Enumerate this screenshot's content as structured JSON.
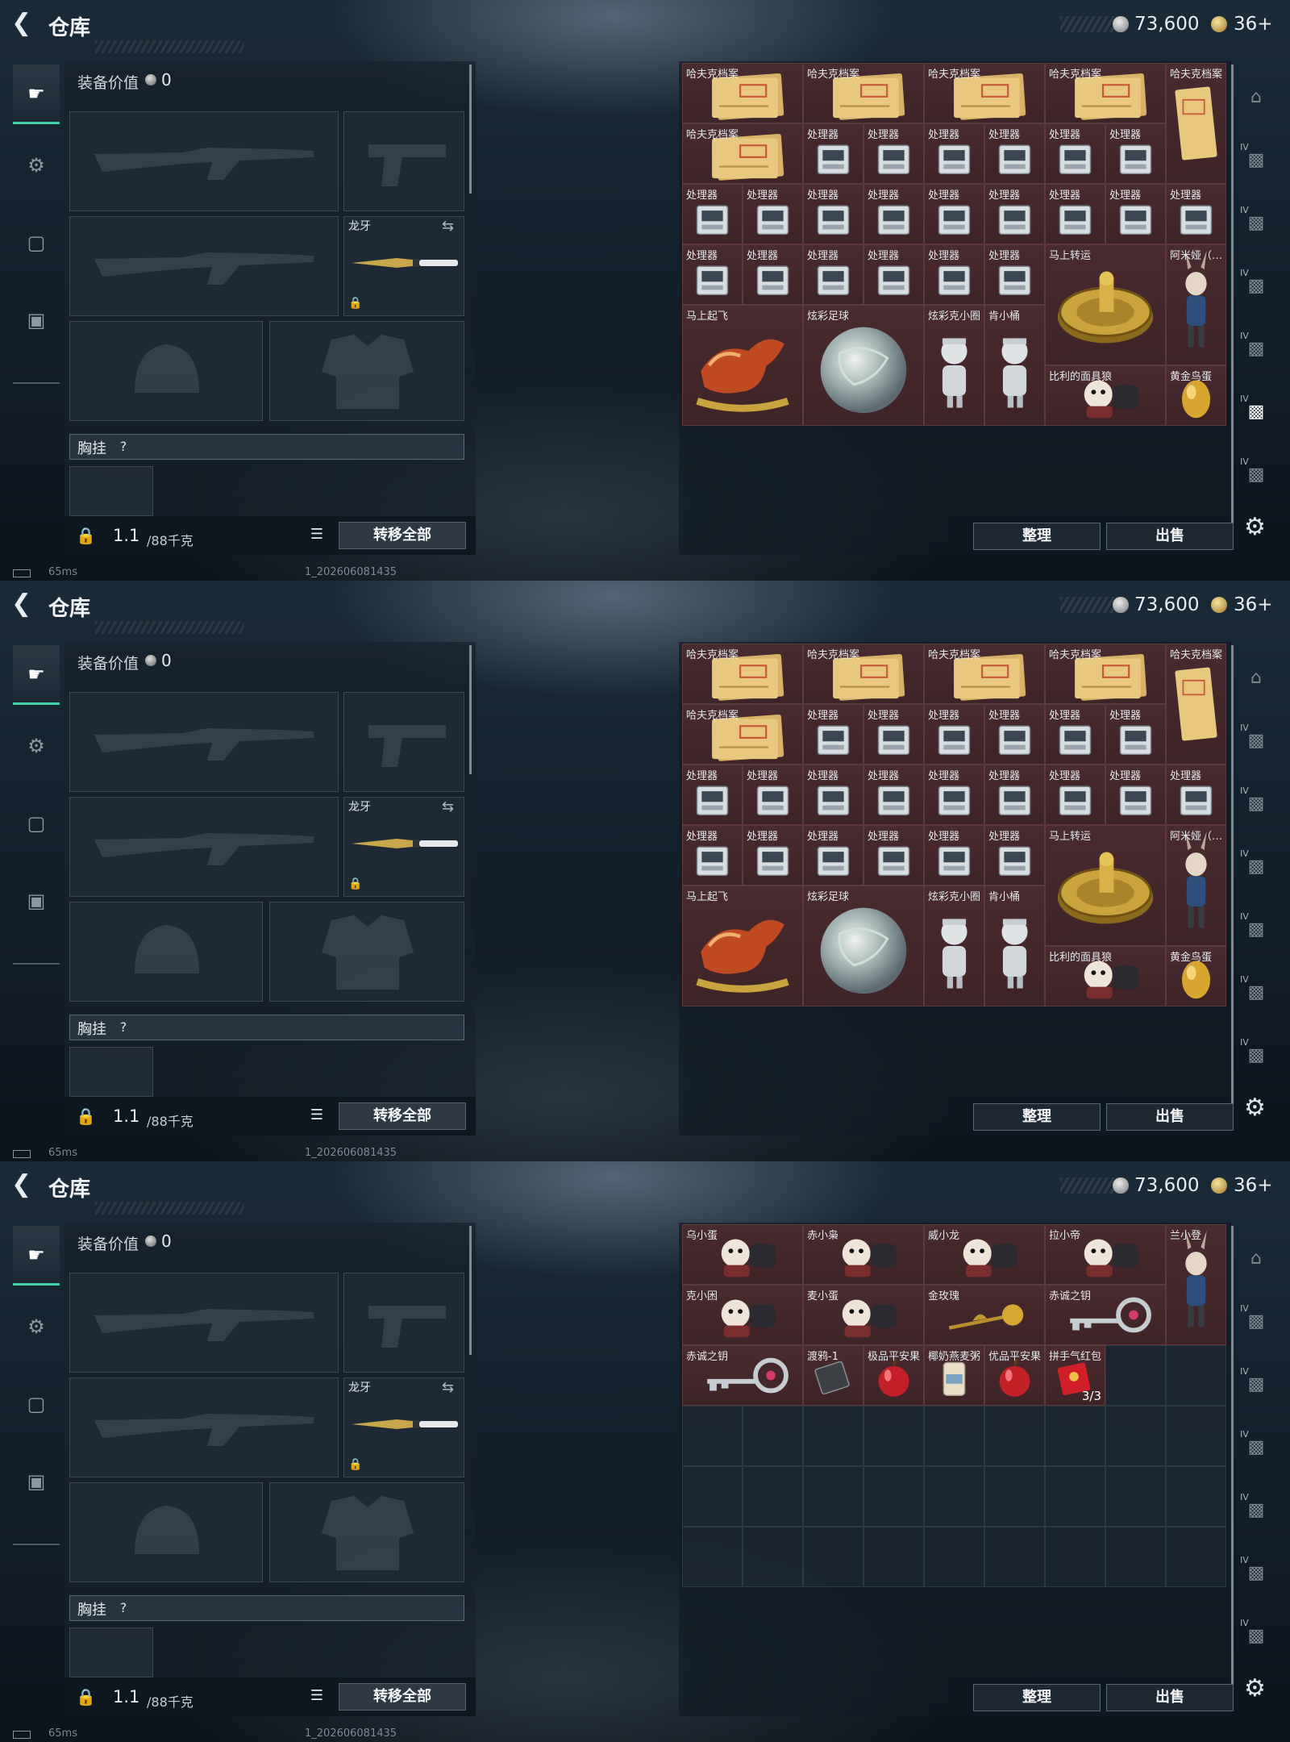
{
  "header": {
    "back_label": "<",
    "title": "仓库",
    "silver": "73,600",
    "gold": "36+"
  },
  "loadout": {
    "value_label": "装备价值",
    "value": "0",
    "melee_name": "龙牙",
    "chest_label": "胸挂",
    "chest_help": "?",
    "weight_value": "1.1",
    "weight_unit": "/88千克",
    "transfer_label": "转移全部"
  },
  "status": {
    "latency": "65ms",
    "build": "1_202606081435"
  },
  "buttons": {
    "sort": "整理",
    "sell": "出售"
  },
  "side_tabs": {
    "tag": "IV"
  },
  "colors": {
    "accent": "#3fd0a6",
    "item_bg": "#4a2b2f"
  },
  "panels": [
    {
      "items": [
        {
          "name": "哈夫克档案",
          "col": 0,
          "row": 0,
          "w": 2,
          "h": 1,
          "icon": "file"
        },
        {
          "name": "哈夫克档案",
          "col": 2,
          "row": 0,
          "w": 2,
          "h": 1,
          "icon": "file"
        },
        {
          "name": "哈夫克档案",
          "col": 4,
          "row": 0,
          "w": 2,
          "h": 1,
          "icon": "file"
        },
        {
          "name": "哈夫克档案",
          "col": 6,
          "row": 0,
          "w": 2,
          "h": 1,
          "icon": "file"
        },
        {
          "name": "哈夫克档案",
          "col": 8,
          "row": 0,
          "w": 1,
          "h": 2,
          "icon": "filev"
        },
        {
          "name": "哈夫克档案",
          "col": 0,
          "row": 1,
          "w": 2,
          "h": 1,
          "icon": "file"
        },
        {
          "name": "处理器",
          "col": 2,
          "row": 1,
          "w": 1,
          "h": 1,
          "icon": "cpu"
        },
        {
          "name": "处理器",
          "col": 3,
          "row": 1,
          "w": 1,
          "h": 1,
          "icon": "cpu"
        },
        {
          "name": "处理器",
          "col": 4,
          "row": 1,
          "w": 1,
          "h": 1,
          "icon": "cpu"
        },
        {
          "name": "处理器",
          "col": 5,
          "row": 1,
          "w": 1,
          "h": 1,
          "icon": "cpu"
        },
        {
          "name": "处理器",
          "col": 6,
          "row": 1,
          "w": 1,
          "h": 1,
          "icon": "cpu"
        },
        {
          "name": "处理器",
          "col": 7,
          "row": 1,
          "w": 1,
          "h": 1,
          "icon": "cpu"
        },
        {
          "name": "处理器",
          "col": 0,
          "row": 2,
          "w": 1,
          "h": 1,
          "icon": "cpu"
        },
        {
          "name": "处理器",
          "col": 1,
          "row": 2,
          "w": 1,
          "h": 1,
          "icon": "cpu"
        },
        {
          "name": "处理器",
          "col": 2,
          "row": 2,
          "w": 1,
          "h": 1,
          "icon": "cpu"
        },
        {
          "name": "处理器",
          "col": 3,
          "row": 2,
          "w": 1,
          "h": 1,
          "icon": "cpu"
        },
        {
          "name": "处理器",
          "col": 4,
          "row": 2,
          "w": 1,
          "h": 1,
          "icon": "cpu"
        },
        {
          "name": "处理器",
          "col": 5,
          "row": 2,
          "w": 1,
          "h": 1,
          "icon": "cpu"
        },
        {
          "name": "处理器",
          "col": 6,
          "row": 2,
          "w": 1,
          "h": 1,
          "icon": "cpu"
        },
        {
          "name": "处理器",
          "col": 7,
          "row": 2,
          "w": 1,
          "h": 1,
          "icon": "cpu"
        },
        {
          "name": "处理器",
          "col": 8,
          "row": 2,
          "w": 1,
          "h": 1,
          "icon": "cpu"
        },
        {
          "name": "处理器",
          "col": 0,
          "row": 3,
          "w": 1,
          "h": 1,
          "icon": "cpu"
        },
        {
          "name": "处理器",
          "col": 1,
          "row": 3,
          "w": 1,
          "h": 1,
          "icon": "cpu"
        },
        {
          "name": "处理器",
          "col": 2,
          "row": 3,
          "w": 1,
          "h": 1,
          "icon": "cpu"
        },
        {
          "name": "处理器",
          "col": 3,
          "row": 3,
          "w": 1,
          "h": 1,
          "icon": "cpu"
        },
        {
          "name": "处理器",
          "col": 4,
          "row": 3,
          "w": 1,
          "h": 1,
          "icon": "cpu"
        },
        {
          "name": "处理器",
          "col": 5,
          "row": 3,
          "w": 1,
          "h": 1,
          "icon": "cpu"
        },
        {
          "name": "马上转运",
          "col": 6,
          "row": 3,
          "w": 2,
          "h": 2,
          "icon": "wheel"
        },
        {
          "name": "阿米娅（…",
          "col": 8,
          "row": 3,
          "w": 1,
          "h": 2,
          "icon": "figure"
        },
        {
          "name": "马上起飞",
          "col": 0,
          "row": 4,
          "w": 2,
          "h": 2,
          "icon": "horse"
        },
        {
          "name": "炫彩足球",
          "col": 2,
          "row": 4,
          "w": 2,
          "h": 2,
          "icon": "ball"
        },
        {
          "name": "炫彩克小圈",
          "col": 4,
          "row": 4,
          "w": 1,
          "h": 2,
          "icon": "statue"
        },
        {
          "name": "肯小桶",
          "col": 5,
          "row": 4,
          "w": 1,
          "h": 2,
          "icon": "statue"
        },
        {
          "name": "比利的面具狼",
          "col": 6,
          "row": 5,
          "w": 2,
          "h": 1,
          "icon": "doll"
        },
        {
          "name": "黄金鸟蛋",
          "col": 8,
          "row": 5,
          "w": 1,
          "h": 1,
          "icon": "egg"
        }
      ]
    },
    {
      "items": [
        {
          "name": "哈夫克档案",
          "col": 0,
          "row": 0,
          "w": 2,
          "h": 1,
          "icon": "file"
        },
        {
          "name": "哈夫克档案",
          "col": 2,
          "row": 0,
          "w": 2,
          "h": 1,
          "icon": "file"
        },
        {
          "name": "哈夫克档案",
          "col": 4,
          "row": 0,
          "w": 2,
          "h": 1,
          "icon": "file"
        },
        {
          "name": "哈夫克档案",
          "col": 6,
          "row": 0,
          "w": 2,
          "h": 1,
          "icon": "file"
        },
        {
          "name": "哈夫克档案",
          "col": 8,
          "row": 0,
          "w": 1,
          "h": 2,
          "icon": "filev"
        },
        {
          "name": "哈夫克档案",
          "col": 0,
          "row": 1,
          "w": 2,
          "h": 1,
          "icon": "file"
        },
        {
          "name": "处理器",
          "col": 2,
          "row": 1,
          "w": 1,
          "h": 1,
          "icon": "cpu"
        },
        {
          "name": "处理器",
          "col": 3,
          "row": 1,
          "w": 1,
          "h": 1,
          "icon": "cpu"
        },
        {
          "name": "处理器",
          "col": 4,
          "row": 1,
          "w": 1,
          "h": 1,
          "icon": "cpu"
        },
        {
          "name": "处理器",
          "col": 5,
          "row": 1,
          "w": 1,
          "h": 1,
          "icon": "cpu"
        },
        {
          "name": "处理器",
          "col": 6,
          "row": 1,
          "w": 1,
          "h": 1,
          "icon": "cpu"
        },
        {
          "name": "处理器",
          "col": 7,
          "row": 1,
          "w": 1,
          "h": 1,
          "icon": "cpu"
        },
        {
          "name": "处理器",
          "col": 0,
          "row": 2,
          "w": 1,
          "h": 1,
          "icon": "cpu"
        },
        {
          "name": "处理器",
          "col": 1,
          "row": 2,
          "w": 1,
          "h": 1,
          "icon": "cpu"
        },
        {
          "name": "处理器",
          "col": 2,
          "row": 2,
          "w": 1,
          "h": 1,
          "icon": "cpu"
        },
        {
          "name": "处理器",
          "col": 3,
          "row": 2,
          "w": 1,
          "h": 1,
          "icon": "cpu"
        },
        {
          "name": "处理器",
          "col": 4,
          "row": 2,
          "w": 1,
          "h": 1,
          "icon": "cpu"
        },
        {
          "name": "处理器",
          "col": 5,
          "row": 2,
          "w": 1,
          "h": 1,
          "icon": "cpu"
        },
        {
          "name": "处理器",
          "col": 6,
          "row": 2,
          "w": 1,
          "h": 1,
          "icon": "cpu"
        },
        {
          "name": "处理器",
          "col": 7,
          "row": 2,
          "w": 1,
          "h": 1,
          "icon": "cpu"
        },
        {
          "name": "处理器",
          "col": 8,
          "row": 2,
          "w": 1,
          "h": 1,
          "icon": "cpu"
        },
        {
          "name": "处理器",
          "col": 0,
          "row": 3,
          "w": 1,
          "h": 1,
          "icon": "cpu"
        },
        {
          "name": "处理器",
          "col": 1,
          "row": 3,
          "w": 1,
          "h": 1,
          "icon": "cpu"
        },
        {
          "name": "处理器",
          "col": 2,
          "row": 3,
          "w": 1,
          "h": 1,
          "icon": "cpu"
        },
        {
          "name": "处理器",
          "col": 3,
          "row": 3,
          "w": 1,
          "h": 1,
          "icon": "cpu"
        },
        {
          "name": "处理器",
          "col": 4,
          "row": 3,
          "w": 1,
          "h": 1,
          "icon": "cpu"
        },
        {
          "name": "处理器",
          "col": 5,
          "row": 3,
          "w": 1,
          "h": 1,
          "icon": "cpu"
        },
        {
          "name": "马上转运",
          "col": 6,
          "row": 3,
          "w": 2,
          "h": 2,
          "icon": "wheel"
        },
        {
          "name": "阿米娅（…",
          "col": 8,
          "row": 3,
          "w": 1,
          "h": 2,
          "icon": "figure"
        },
        {
          "name": "马上起飞",
          "col": 0,
          "row": 4,
          "w": 2,
          "h": 2,
          "icon": "horse"
        },
        {
          "name": "炫彩足球",
          "col": 2,
          "row": 4,
          "w": 2,
          "h": 2,
          "icon": "ball"
        },
        {
          "name": "炫彩克小圈",
          "col": 4,
          "row": 4,
          "w": 1,
          "h": 2,
          "icon": "statue"
        },
        {
          "name": "肯小桶",
          "col": 5,
          "row": 4,
          "w": 1,
          "h": 2,
          "icon": "statue"
        },
        {
          "name": "比利的面具狼",
          "col": 6,
          "row": 5,
          "w": 2,
          "h": 1,
          "icon": "doll"
        },
        {
          "name": "黄金鸟蛋",
          "col": 8,
          "row": 5,
          "w": 1,
          "h": 1,
          "icon": "egg"
        }
      ]
    },
    {
      "items": [
        {
          "name": "乌小蛋",
          "col": 0,
          "row": 0,
          "w": 2,
          "h": 1,
          "icon": "doll"
        },
        {
          "name": "赤小枭",
          "col": 2,
          "row": 0,
          "w": 2,
          "h": 1,
          "icon": "doll"
        },
        {
          "name": "威小龙",
          "col": 4,
          "row": 0,
          "w": 2,
          "h": 1,
          "icon": "doll"
        },
        {
          "name": "拉小帝",
          "col": 6,
          "row": 0,
          "w": 2,
          "h": 1,
          "icon": "doll"
        },
        {
          "name": "兰小登",
          "col": 8,
          "row": 0,
          "w": 1,
          "h": 2,
          "icon": "figure"
        },
        {
          "name": "克小困",
          "col": 0,
          "row": 1,
          "w": 2,
          "h": 1,
          "icon": "doll"
        },
        {
          "name": "麦小蛋",
          "col": 2,
          "row": 1,
          "w": 2,
          "h": 1,
          "icon": "doll"
        },
        {
          "name": "金玫瑰",
          "col": 4,
          "row": 1,
          "w": 2,
          "h": 1,
          "icon": "rose"
        },
        {
          "name": "赤诚之钥",
          "col": 6,
          "row": 1,
          "w": 2,
          "h": 1,
          "icon": "key"
        },
        {
          "name": "赤诚之钥",
          "col": 0,
          "row": 2,
          "w": 2,
          "h": 1,
          "icon": "key"
        },
        {
          "name": "渡鸦-1",
          "col": 2,
          "row": 2,
          "w": 1,
          "h": 1,
          "icon": "card"
        },
        {
          "name": "极品平安果",
          "col": 3,
          "row": 2,
          "w": 1,
          "h": 1,
          "icon": "apple"
        },
        {
          "name": "椰奶燕麦粥",
          "col": 4,
          "row": 2,
          "w": 1,
          "h": 1,
          "icon": "can"
        },
        {
          "name": "优品平安果",
          "col": 5,
          "row": 2,
          "w": 1,
          "h": 1,
          "icon": "apple"
        },
        {
          "name": "拼手气红包",
          "col": 6,
          "row": 2,
          "w": 1,
          "h": 1,
          "icon": "envelope",
          "count": "3/3"
        }
      ]
    }
  ]
}
